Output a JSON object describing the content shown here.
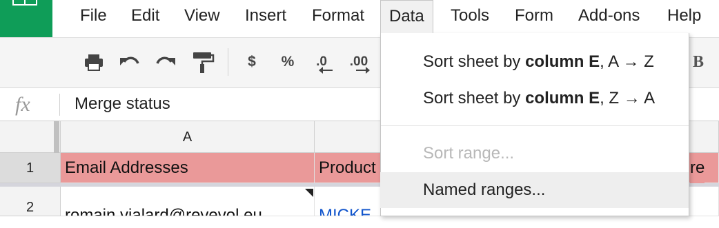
{
  "menu": {
    "items": [
      "File",
      "Edit",
      "View",
      "Insert",
      "Format",
      "Data",
      "Tools",
      "Form",
      "Add-ons",
      "Help"
    ],
    "open_item": "Data"
  },
  "toolbar": {
    "print_icon": "print-icon",
    "undo_icon": "undo-icon",
    "redo_icon": "redo-icon",
    "paint_format_icon": "paint-format-icon",
    "currency": "$",
    "percent": "%",
    "decrease_decimal": ".0",
    "increase_decimal": ".00",
    "bold": "B"
  },
  "formula_bar": {
    "fx": "fx",
    "content": "Merge status"
  },
  "grid": {
    "col_a": "A",
    "row_1": "1",
    "row_2": "2",
    "a1": "Email Addresses",
    "b1": "Product",
    "c1_tail": "re",
    "a2": "romain.vialard@revevol.eu",
    "b2": "MICKE"
  },
  "data_menu": {
    "sort_az_prefix": "Sort sheet by ",
    "sort_az_bold": "column E",
    "sort_az_suffix": ", A → Z",
    "sort_za_prefix": "Sort sheet by ",
    "sort_za_bold": "column E",
    "sort_za_suffix": ", Z → A",
    "sort_range": "Sort range...",
    "named_ranges": "Named ranges..."
  },
  "colors": {
    "header_fill": "#ea9999",
    "brand_green": "#0f9d58",
    "link_blue": "#1155cc"
  }
}
